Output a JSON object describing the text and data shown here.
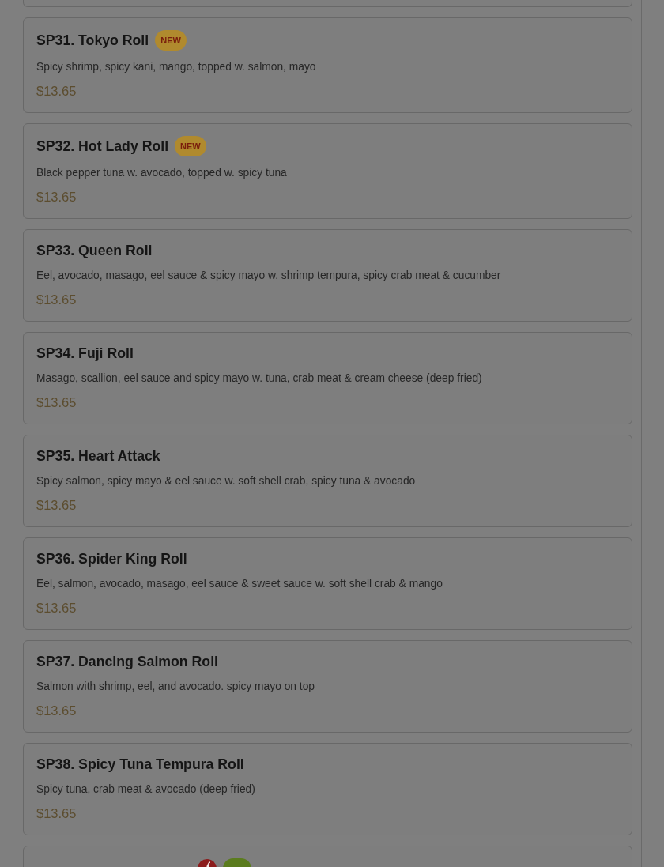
{
  "items": [
    {
      "name": "SP31. Tokyo Roll",
      "badges": [
        {
          "kind": "new",
          "label": "NEW"
        }
      ],
      "description": "Spicy shrimp, spicy kani, mango, topped w. salmon, mayo",
      "price": "$13.65"
    },
    {
      "name": "SP32. Hot Lady Roll",
      "badges": [
        {
          "kind": "new",
          "label": "NEW"
        }
      ],
      "description": "Black pepper tuna w. avocado, topped w. spicy tuna",
      "price": "$13.65"
    },
    {
      "name": "SP33. Queen Roll",
      "description": "Eel, avocado, masago, eel sauce & spicy mayo w. shrimp tempura, spicy crab meat & cucumber",
      "price": "$13.65"
    },
    {
      "name": "SP34. Fuji Roll",
      "description": "Masago, scallion, eel sauce and spicy mayo w. tuna, crab meat & cream cheese (deep fried)",
      "price": "$13.65"
    },
    {
      "name": "SP35. Heart Attack",
      "description": "Spicy salmon, spicy mayo & eel sauce w. soft shell crab, spicy tuna & avocado",
      "price": "$13.65"
    },
    {
      "name": "SP36. Spider King Roll",
      "description": "Eel, salmon, avocado, masago, eel sauce & sweet sauce w. soft shell crab & mango",
      "price": "$13.65"
    },
    {
      "name": "SP37. Dancing Salmon Roll",
      "description": "Salmon with shrimp, eel, and avocado. spicy mayo on top",
      "price": "$13.65"
    },
    {
      "name": "SP38. Spicy Tuna Tempura Roll",
      "description": "Spicy tuna, crab meat & avocado (deep fried)",
      "price": "$13.65"
    },
    {
      "badges": [
        {
          "kind": "spicy"
        },
        {
          "kind": "raw"
        }
      ]
    }
  ]
}
